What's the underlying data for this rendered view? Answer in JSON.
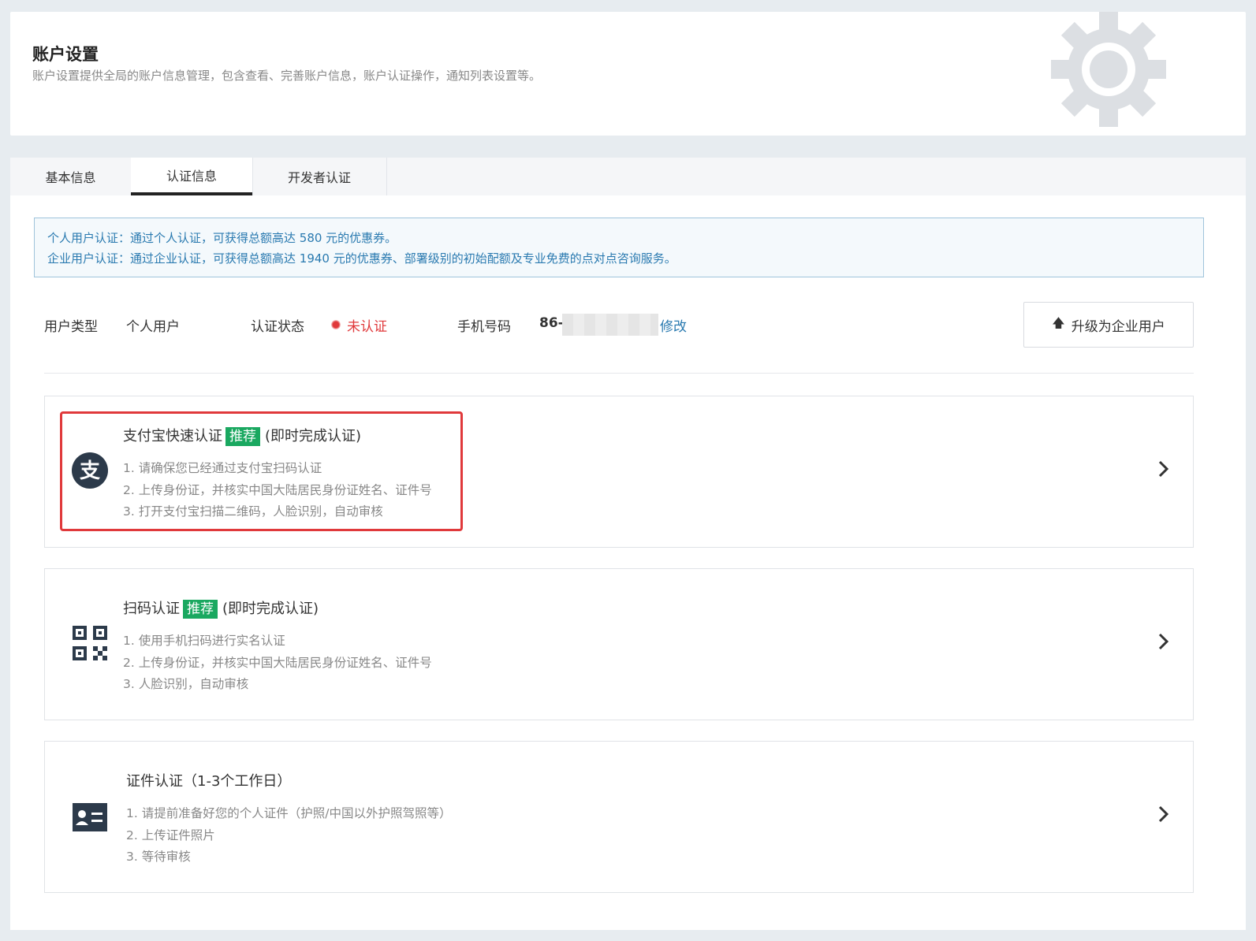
{
  "header": {
    "title": "账户设置",
    "description": "账户设置提供全局的账户信息管理，包含查看、完善账户信息，账户认证操作，通知列表设置等。"
  },
  "tabs": [
    {
      "label": "基本信息",
      "active": false
    },
    {
      "label": "认证信息",
      "active": true
    },
    {
      "label": "开发者认证",
      "active": false
    }
  ],
  "notice": {
    "line1": "个人用户认证：通过个人认证，可获得总额高达 580 元的优惠券。",
    "line2": "企业用户认证：通过企业认证，可获得总额高达 1940 元的优惠券、部署级别的初始配额及专业免费的点对点咨询服务。"
  },
  "account": {
    "user_type_label": "用户类型",
    "user_type_value": "个人用户",
    "status_label": "认证状态",
    "status_value": "未认证",
    "phone_label": "手机号码",
    "phone_prefix": "86-",
    "edit_link": "修改"
  },
  "upgrade_button": "升级为企业用户",
  "methods": [
    {
      "title": "支付宝快速认证",
      "tag": "推荐",
      "suffix": "(即时完成认证)",
      "icon": "alipay-icon",
      "steps": [
        "1. 请确保您已经通过支付宝扫码认证",
        "2. 上传身份证，并核实中国大陆居民身份证姓名、证件号",
        "3. 打开支付宝扫描二维码，人脸识别，自动审核"
      ]
    },
    {
      "title": "扫码认证",
      "tag": "推荐",
      "suffix": "(即时完成认证)",
      "icon": "qrcode-icon",
      "steps": [
        "1. 使用手机扫码进行实名认证",
        "2. 上传身份证，并核实中国大陆居民身份证姓名、证件号",
        "3. 人脸识别，自动审核"
      ]
    },
    {
      "title": "证件认证（1-3个工作日）",
      "icon": "id-card-icon",
      "steps": [
        "1. 请提前准备好您的个人证件（护照/中国以外护照驾照等）",
        "2. 上传证件照片",
        "3. 等待审核"
      ]
    }
  ],
  "colors": {
    "accent_green": "#1aa860",
    "status_red": "#e0393b",
    "link_blue": "#2a7ab0",
    "highlight_red": "#e0393b"
  }
}
